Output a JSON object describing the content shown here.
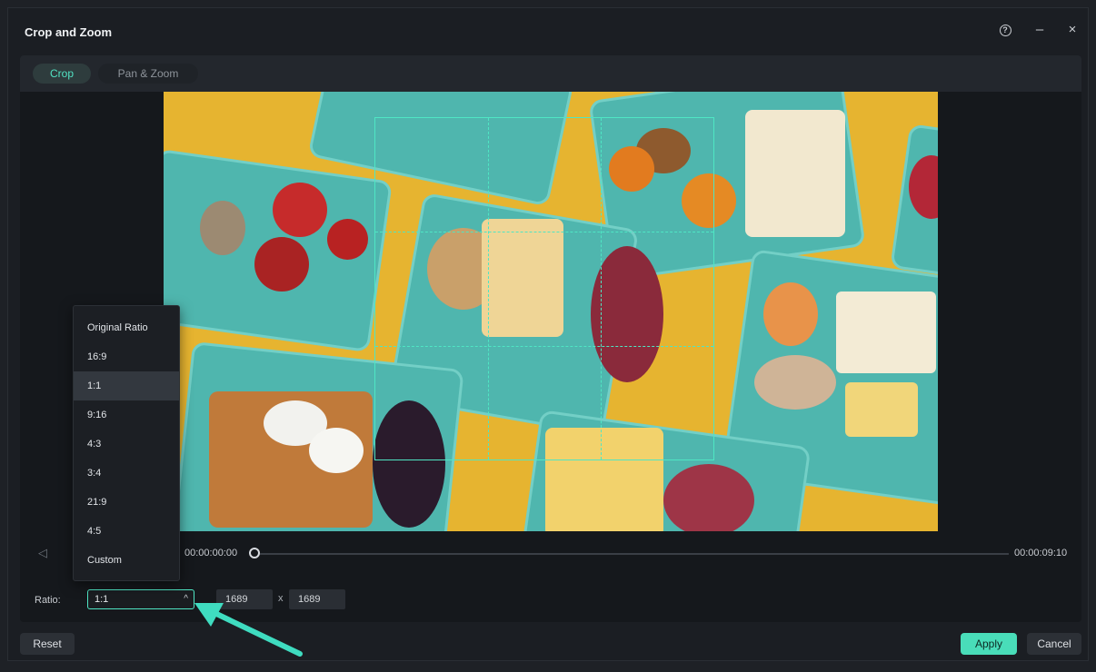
{
  "window": {
    "title": "Crop and Zoom"
  },
  "title_controls": {
    "help": "?",
    "minimize": "–",
    "close": "×"
  },
  "tabs": [
    {
      "label": "Crop",
      "active": true
    },
    {
      "label": "Pan & Zoom",
      "active": false
    }
  ],
  "timeline": {
    "current_time": "00:00:00:00",
    "end_time": "00:00:09:10",
    "progress": 0.0
  },
  "ratio": {
    "label": "Ratio:",
    "selected": "1:1",
    "width": "1689",
    "separator": "x",
    "height": "1689",
    "options": [
      "Original Ratio",
      "16:9",
      "1:1",
      "9:16",
      "4:3",
      "3:4",
      "21:9",
      "4:5",
      "Custom"
    ],
    "selected_index": 2
  },
  "buttons": {
    "reset": "Reset",
    "apply": "Apply",
    "cancel": "Cancel"
  },
  "colors": {
    "accent": "#49ddb9",
    "crop_frame": "#4fe6c4",
    "background": "#1b1e23",
    "image_bg": "#e6b430"
  },
  "icons": {
    "help": "help-circle-icon",
    "minimize": "minimize-icon",
    "close": "close-icon",
    "prev": "previous-frame-icon",
    "step": "step-icon",
    "caret": "chevron-up-icon"
  }
}
